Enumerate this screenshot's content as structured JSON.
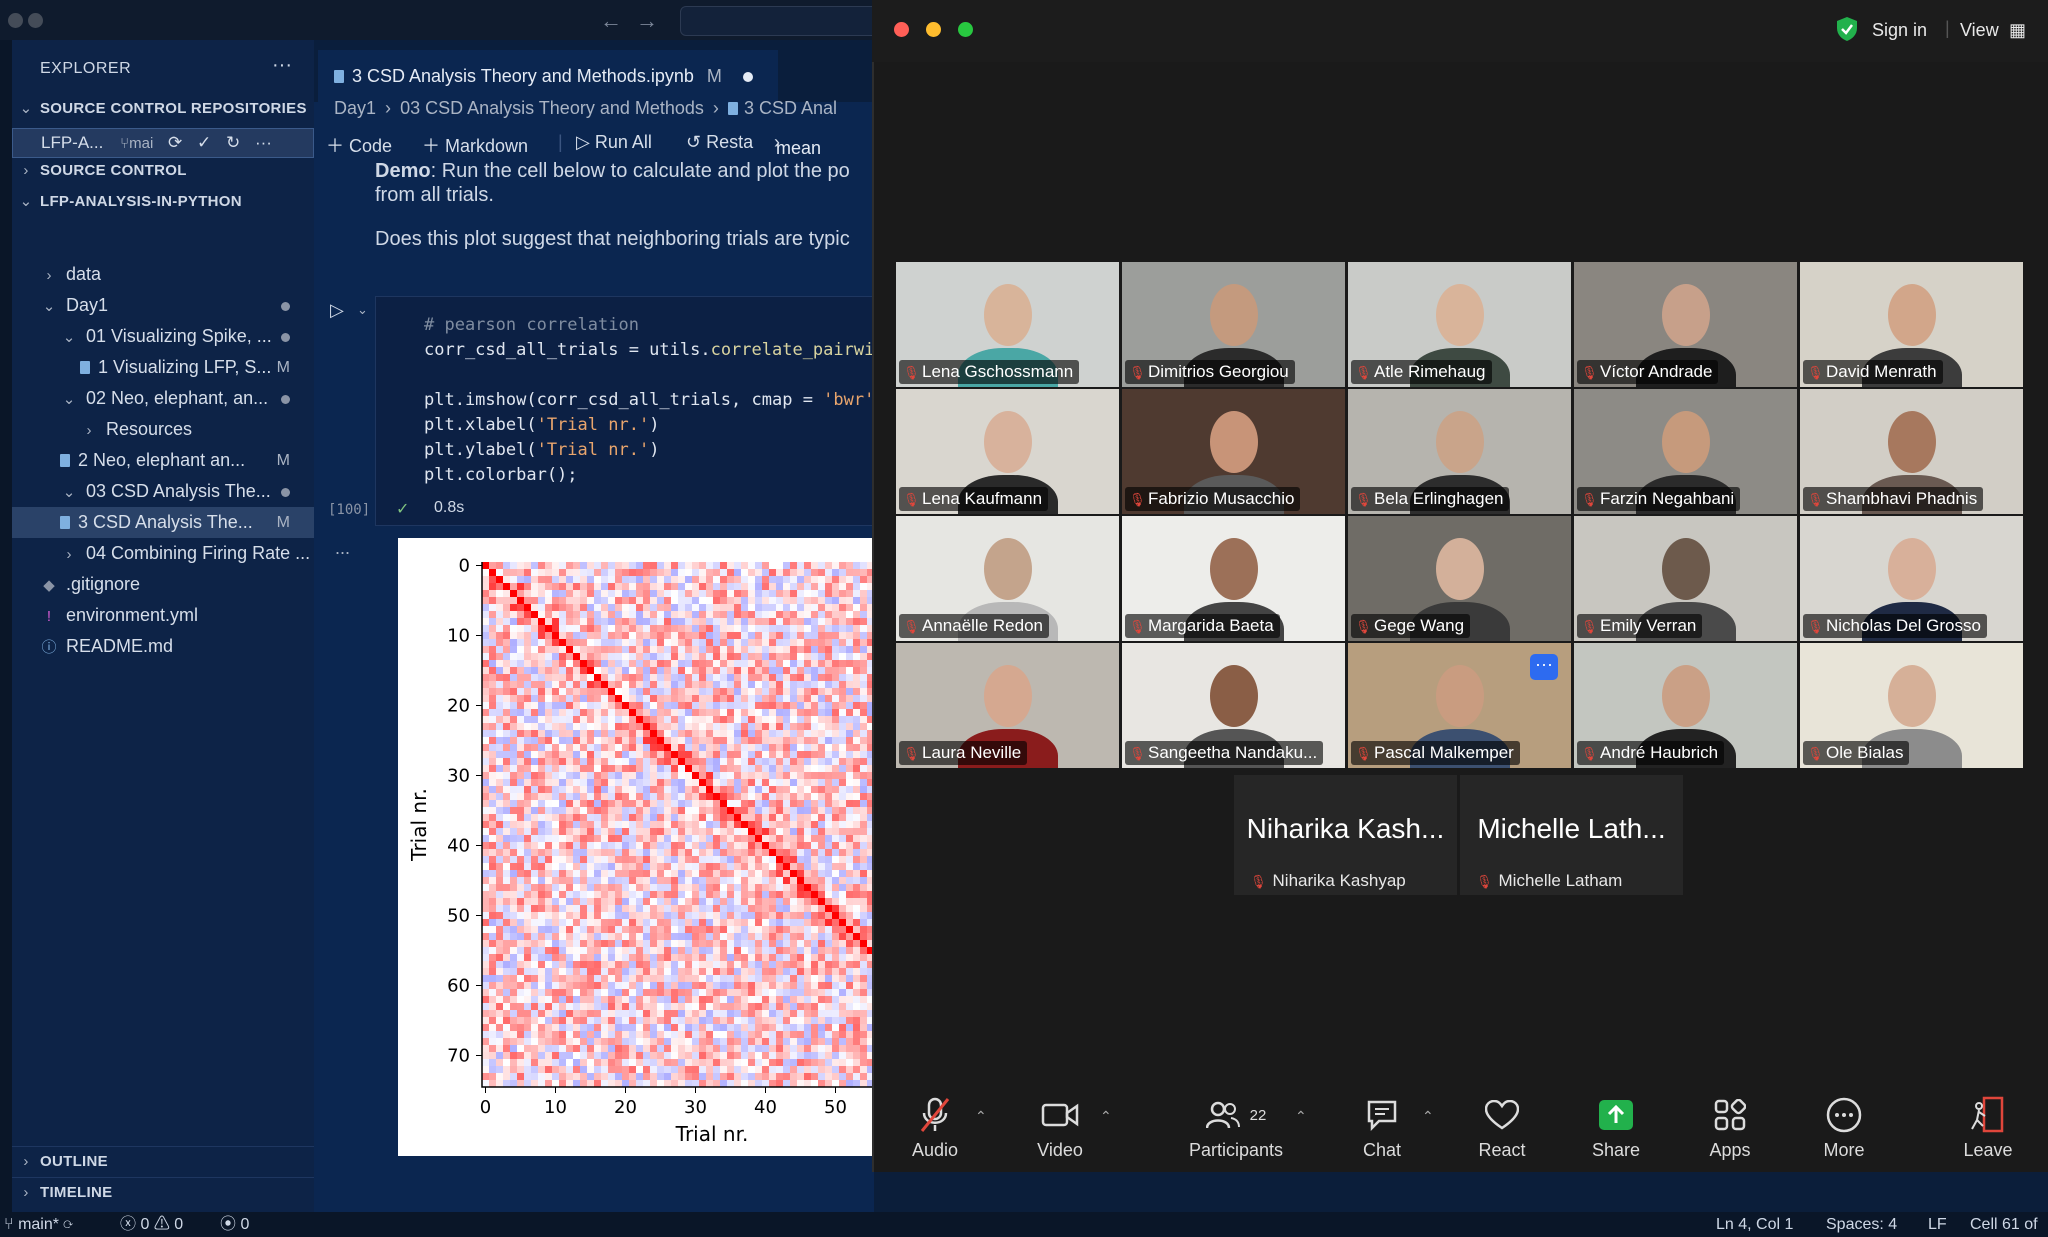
{
  "vscode": {
    "explorer_title": "EXPLORER",
    "sections": {
      "source_control_repos": "SOURCE CONTROL REPOSITORIES",
      "source_control": "SOURCE CONTROL",
      "project": "LFP-ANALYSIS-IN-PYTHON",
      "outline": "OUTLINE",
      "timeline": "TIMELINE"
    },
    "repo": {
      "name": "LFP-A...",
      "branch": "mai"
    },
    "tree": [
      {
        "label": "data",
        "indent": 1,
        "chevron": "›",
        "mark": ""
      },
      {
        "label": "Day1",
        "indent": 1,
        "chevron": "⌄",
        "mark": "dot"
      },
      {
        "label": "01 Visualizing Spike, ...",
        "indent": 2,
        "chevron": "⌄",
        "mark": "dot"
      },
      {
        "label": "1 Visualizing LFP, S...",
        "indent": 3,
        "chevron": "nb",
        "mark": "M"
      },
      {
        "label": "02 Neo, elephant, an...",
        "indent": 2,
        "chevron": "⌄",
        "mark": "dot"
      },
      {
        "label": "Resources",
        "indent": 3,
        "chevron": "›",
        "mark": ""
      },
      {
        "label": "2 Neo, elephant an...",
        "indent": 2,
        "chevron": "nb",
        "mark": "M"
      },
      {
        "label": "03 CSD Analysis The...",
        "indent": 2,
        "chevron": "⌄",
        "mark": "dot"
      },
      {
        "label": "3 CSD Analysis The...",
        "indent": 2,
        "chevron": "nb",
        "mark": "M",
        "selected": true
      },
      {
        "label": "04 Combining Firing Rate ...",
        "indent": 2,
        "chevron": "›",
        "mark": ""
      },
      {
        "label": ".gitignore",
        "indent": 1,
        "chevron": "◆",
        "mark": ""
      },
      {
        "label": "environment.yml",
        "indent": 1,
        "chevron": "!",
        "mark": ""
      },
      {
        "label": "README.md",
        "indent": 1,
        "chevron": "ⓘ",
        "mark": ""
      }
    ],
    "tab": {
      "label": "3 CSD Analysis Theory and Methods.ipynb",
      "flag": "M"
    },
    "breadcrumbs": [
      "Day1",
      "03 CSD Analysis Theory and Methods",
      "3 CSD Anal"
    ],
    "toolbar": {
      "code": "Code",
      "markdown": "Markdown",
      "run_all": "Run All",
      "restart": "Resta",
      "kernel": "mean"
    },
    "markdown": {
      "demo_bold": "Demo",
      "line1": ": Run the cell below to calculate and plot the po",
      "line2": "from all trials.",
      "line3": "Does this plot suggest that neighboring trials are typic"
    },
    "cell": {
      "exec_count": "[100]",
      "time": "0.8s",
      "comment": "# pearson correlation",
      "l1a": "corr_csd_all_trials = utils.",
      "l1b": "correlate_pairwi",
      "l3a": "plt.imshow(corr_csd_all_trials, cmap = ",
      "l3b": "'bwr'",
      "l4a": "plt.xlabel(",
      "l4b": "'Trial nr.'",
      "l4c": ")",
      "l5a": "plt.ylabel(",
      "l5b": "'Trial nr.'",
      "l5c": ")",
      "l6": "plt.colorbar();",
      "more": "..."
    },
    "status": {
      "branch": "main*",
      "errors": "0",
      "warnings": "0",
      "ports": "0",
      "position": "Ln 4, Col 1",
      "spaces": "Spaces: 4",
      "eol": "LF",
      "cell": "Cell 61 of"
    }
  },
  "chart_data": {
    "type": "heatmap",
    "xlabel": "Trial nr.",
    "ylabel": "Trial nr.",
    "x_ticks": [
      0,
      10,
      20,
      30,
      40,
      50
    ],
    "y_ticks": [
      0,
      10,
      20,
      30,
      40,
      50,
      60,
      70
    ],
    "x_visible_range": [
      0,
      56
    ],
    "y_range": [
      0,
      75
    ],
    "colormap": "bwr",
    "diagonal": 1.0
  },
  "zoom": {
    "sign_in": "Sign in",
    "view": "View",
    "participants": [
      {
        "name": "Lena Gschossmann",
        "bg": "#cfd2d0",
        "skin": "#d8b49a",
        "shirt": "#4aa7a5"
      },
      {
        "name": "Dimitrios Georgiou",
        "bg": "#9c9e9b",
        "skin": "#c49a7e",
        "shirt": "#2b2b2b"
      },
      {
        "name": "Atle Rimehaug",
        "bg": "#c9cbc8",
        "skin": "#d9b49a",
        "shirt": "#3e4a42"
      },
      {
        "name": "Víctor Andrade",
        "bg": "#8a8680",
        "skin": "#c7a08a",
        "shirt": "#1e1e1e"
      },
      {
        "name": "David Menrath",
        "bg": "#d6d2c8",
        "skin": "#d2a68a",
        "shirt": "#3c3c3c"
      },
      {
        "name": "Lena Kaufmann",
        "bg": "#d9d6cf",
        "skin": "#d8b29c",
        "shirt": "#2a2a2a"
      },
      {
        "name": "Fabrizio Musacchio",
        "bg": "#4f3a30",
        "skin": "#c89478",
        "shirt": "#5a5a5a"
      },
      {
        "name": "Bela Erlinghagen",
        "bg": "#b6b4ae",
        "skin": "#c9a48a",
        "shirt": "#2d2d2d"
      },
      {
        "name": "Farzin Negahbani",
        "bg": "#8d8b86",
        "skin": "#c69a7c",
        "shirt": "#2b2b2b"
      },
      {
        "name": "Shambhavi Phadnis",
        "bg": "#d2cec6",
        "skin": "#a7785e",
        "shirt": "#6a5a52"
      },
      {
        "name": "Annaëlle Redon",
        "bg": "#e6e6e2",
        "skin": "#c4a48c",
        "shirt": "#b8b8b8"
      },
      {
        "name": "Margarida Baeta",
        "bg": "#ededea",
        "skin": "#9c7058",
        "shirt": "#444"
      },
      {
        "name": "Gege Wang",
        "bg": "#6f6c66",
        "skin": "#d3b09a",
        "shirt": "#3a3a3a"
      },
      {
        "name": "Emily Verran",
        "bg": "#c8c6c0",
        "skin": "#6d5a4c",
        "shirt": "#4a4a4a"
      },
      {
        "name": "Nicholas Del Grosso",
        "bg": "#d8d6d0",
        "skin": "#d8b09a",
        "shirt": "#1f2a44"
      },
      {
        "name": "Laura Neville",
        "bg": "#bdb8b0",
        "skin": "#d5a890",
        "shirt": "#8a1c1c"
      },
      {
        "name": "Sangeetha Nandaku...",
        "bg": "#e8e6e2",
        "skin": "#8a5e46",
        "shirt": "#555"
      },
      {
        "name": "Pascal Malkemper",
        "bg": "#b79e7e",
        "skin": "#c99c80",
        "shirt": "#3c5070"
      },
      {
        "name": "André Haubrich",
        "bg": "#c3c6c0",
        "skin": "#caa086",
        "shirt": "#222"
      },
      {
        "name": "Ole Bialas",
        "bg": "#e8e4d8",
        "skin": "#d6b098",
        "shirt": "#8c8c8c"
      }
    ],
    "overflow": [
      {
        "big": "Niharika Kash...",
        "small": "Niharika Kashyap"
      },
      {
        "big": "Michelle Lath...",
        "small": "Michelle Latham"
      }
    ],
    "toolbar": {
      "audio": "Audio",
      "video": "Video",
      "participants": "Participants",
      "participants_count": "22",
      "chat": "Chat",
      "react": "React",
      "share": "Share",
      "apps": "Apps",
      "more": "More",
      "leave": "Leave"
    },
    "colors": {
      "share": "#22b14c",
      "muted": "#e0463b",
      "leave": "#e0463b",
      "more_badge": "#2d6bf0"
    }
  }
}
